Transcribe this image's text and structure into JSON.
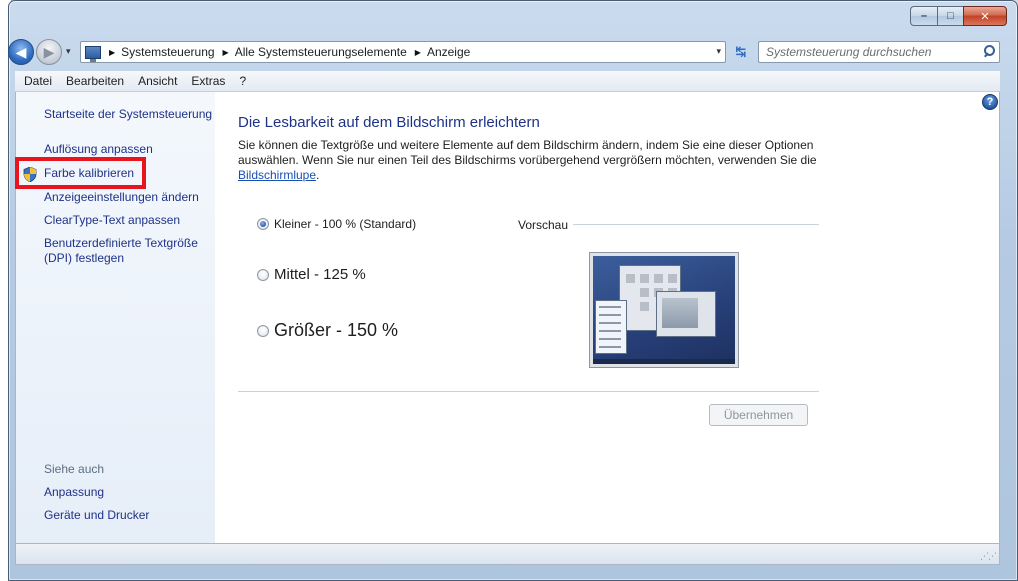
{
  "window": {
    "caption": {
      "minimize": "–",
      "maximize": "□",
      "close": "✕"
    }
  },
  "nav": {
    "back": "◀",
    "forward": "▶",
    "history": "▾",
    "breadcrumbs": [
      "Systemsteuerung",
      "Alle Systemsteuerungselemente",
      "Anzeige"
    ],
    "separator": "▶",
    "dropdown": "▾",
    "refresh": "↹",
    "search_placeholder": "Systemsteuerung durchsuchen"
  },
  "menu": [
    "Datei",
    "Bearbeiten",
    "Ansicht",
    "Extras",
    "?"
  ],
  "sidebar": {
    "home": "Startseite der Systemsteuerung",
    "links": [
      "Auflösung anpassen",
      "Farbe kalibrieren",
      "Anzeigeeinstellungen ändern",
      "ClearType-Text anpassen",
      "Benutzerdefinierte Textgröße (DPI) festlegen"
    ],
    "see_also": "Siehe auch",
    "see_also_links": [
      "Anpassung",
      "Geräte und Drucker"
    ]
  },
  "main": {
    "help": "?",
    "title": "Die Lesbarkeit auf dem Bildschirm erleichtern",
    "intro": "Sie können die Textgröße und weitere Elemente auf dem Bildschirm ändern, indem Sie eine dieser Optionen auswählen. Wenn Sie nur einen Teil des Bildschirms vorübergehend vergrößern möchten, verwenden Sie die ",
    "magnifier_link": "Bildschirmlupe",
    "intro_end": ".",
    "options": [
      {
        "label": "Kleiner - 100 % (Standard)",
        "checked": true
      },
      {
        "label": "Mittel - 125 %",
        "checked": false
      },
      {
        "label": "Größer - 150 %",
        "checked": false
      }
    ],
    "preview_label": "Vorschau",
    "apply": "Übernehmen"
  },
  "status": {
    "grip": "⋰⋰"
  },
  "colors": {
    "highlight": "#e8141e",
    "link": "#1e3287",
    "title": "#1e3287"
  }
}
